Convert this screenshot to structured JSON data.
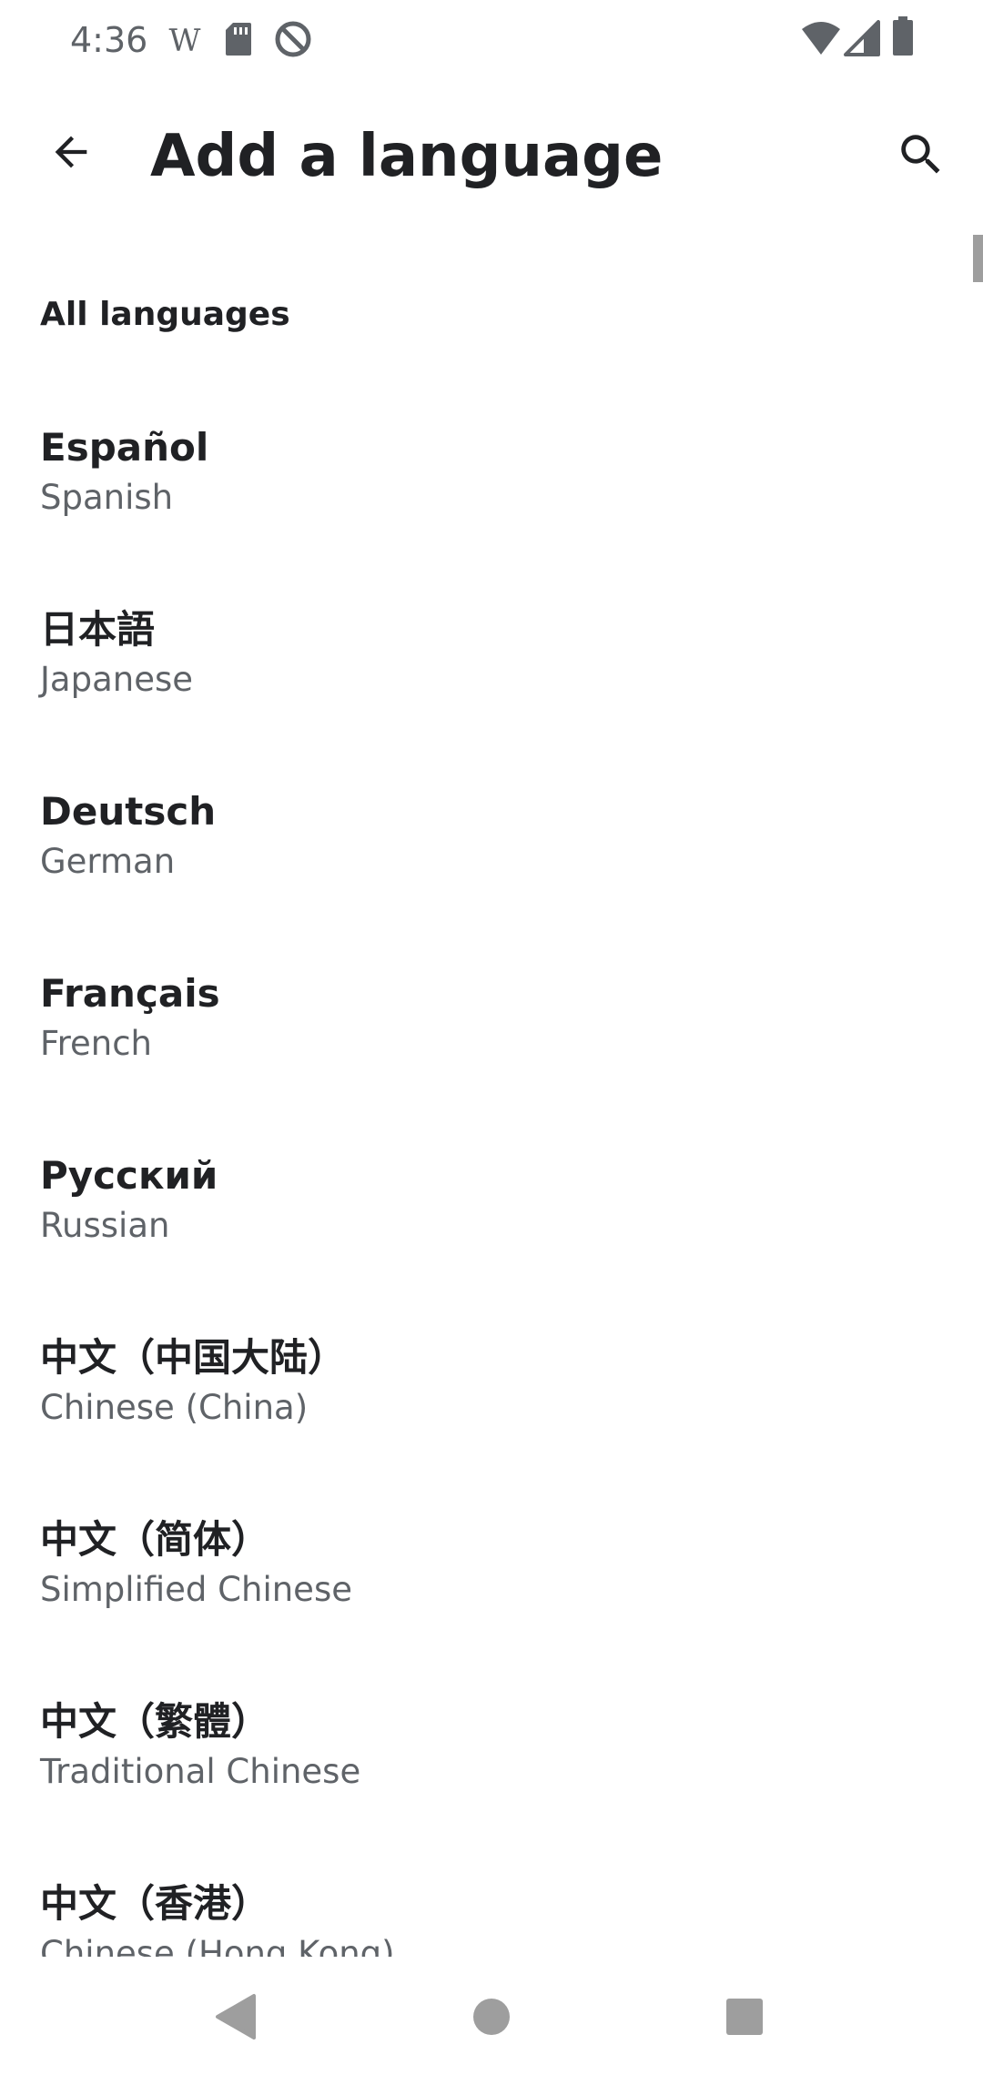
{
  "status_bar": {
    "time": "4:36",
    "icons_left": [
      "wikipedia-w-icon",
      "sd-card-icon",
      "do-not-disturb-icon"
    ],
    "icons_right": [
      "wifi-icon",
      "cellular-signal-icon",
      "battery-icon"
    ]
  },
  "app_bar": {
    "title": "Add a language",
    "back_icon": "arrow-back-icon",
    "search_icon": "search-icon"
  },
  "section": {
    "header": "All languages"
  },
  "languages": [
    {
      "native": "Español",
      "english": "Spanish"
    },
    {
      "native": "日本語",
      "english": "Japanese"
    },
    {
      "native": "Deutsch",
      "english": "German"
    },
    {
      "native": "Français",
      "english": "French"
    },
    {
      "native": "Русский",
      "english": "Russian"
    },
    {
      "native": "中文（中国大陆）",
      "english": "Chinese (China)"
    },
    {
      "native": "中文（简体）",
      "english": "Simplified Chinese"
    },
    {
      "native": "中文（繁體）",
      "english": "Traditional Chinese"
    },
    {
      "native": "中文（香港）",
      "english": "Chinese (Hong Kong)"
    }
  ],
  "nav_bar": {
    "back": "back-triangle-icon",
    "home": "home-circle-icon",
    "recents": "recents-square-icon"
  },
  "colors": {
    "primary_text": "#202124",
    "secondary_text": "#5f6368",
    "icon_gray": "#5f6368",
    "nav_gray": "#9e9e9e",
    "background": "#ffffff"
  }
}
